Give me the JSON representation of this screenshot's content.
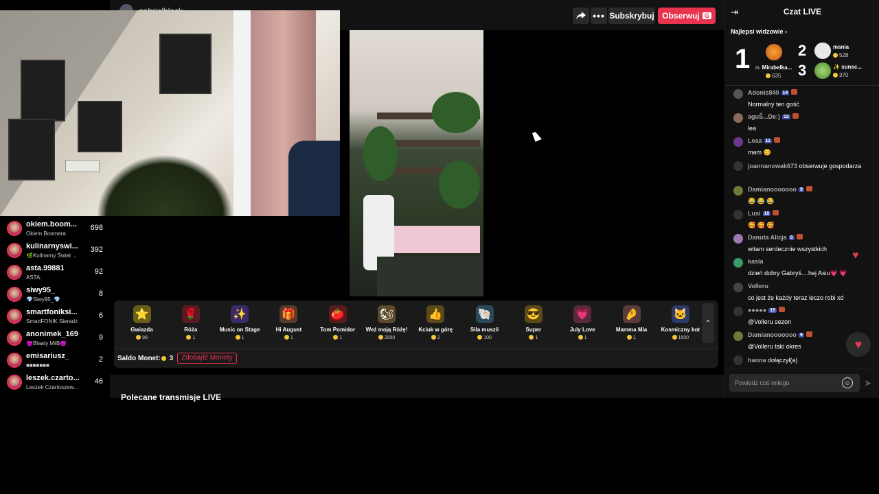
{
  "header": {
    "host_name": "gabrielblack",
    "share_icon": "share-icon",
    "more_label": "•••",
    "subscribe_label": "Subskrybuj",
    "follow_label": "Obserwuj",
    "follow_shortcut": "G"
  },
  "ranking": [
    {
      "name": "okiem.boom...",
      "sub": "Okiem Boomera",
      "score": "698"
    },
    {
      "name": "kulinarnyswi...",
      "sub": "🌿Kulinarny Świat ...",
      "score": "392"
    },
    {
      "name": "asta.99881",
      "sub": "ASTA.",
      "score": "92"
    },
    {
      "name": "siwy95_",
      "sub": "💎Siwy95_💎",
      "score": "8"
    },
    {
      "name": "smartfoniksi...",
      "sub": "SmartFONIK Sieradz",
      "score": "6"
    },
    {
      "name": "anonimek_169",
      "sub": "😈Blaaty Mił$😈",
      "score": "9"
    },
    {
      "name": "emisariusz_",
      "sub": "■■■■■■■",
      "score": "2"
    },
    {
      "name": "leszek.czarto...",
      "sub": "Leszek Czartoszew...",
      "score": "46"
    }
  ],
  "gifts": [
    {
      "name": "Gwiazda",
      "price": "99",
      "icon": "⭐",
      "color": "#6b5d1a"
    },
    {
      "name": "Róża",
      "price": "1",
      "icon": "🌹",
      "color": "#5a1a22"
    },
    {
      "name": "Music on Stage",
      "price": "1",
      "icon": "✨",
      "color": "#3a2a6a"
    },
    {
      "name": "Hi August",
      "price": "1",
      "icon": "🎁",
      "color": "#5a3a2a"
    },
    {
      "name": "Tom Pomidor",
      "price": "1",
      "icon": "🍅",
      "color": "#5a1a1a"
    },
    {
      "name": "Weź moją Różę!",
      "price": "2000",
      "icon": "🐿",
      "color": "#5a4a2a"
    },
    {
      "name": "Kciuk w górę",
      "price": "2",
      "icon": "👍",
      "color": "#5a4a1a"
    },
    {
      "name": "Siła muszli",
      "price": "100",
      "icon": "🐚",
      "color": "#2a4a5a"
    },
    {
      "name": "Super",
      "price": "1",
      "icon": "😎",
      "color": "#5a4a1a"
    },
    {
      "name": "July Love",
      "price": "1",
      "icon": "💗",
      "color": "#5a2a3a"
    },
    {
      "name": "Mamma Mia",
      "price": "1",
      "icon": "🤌",
      "color": "#5a3a3a"
    },
    {
      "name": "Kosmiczny kot",
      "price": "1500",
      "icon": "🐱",
      "color": "#2a3a6a"
    }
  ],
  "balance": {
    "label": "Saldo Monet:",
    "value": "3",
    "get_coins": "Zdobądź Monety"
  },
  "recommended_title": "Polecane transmisje LIVE",
  "chat": {
    "title": "Czat LIVE",
    "top_viewers": "Najlepsi widzowie",
    "podium": [
      {
        "rank": "1",
        "name": "Mirabelka...",
        "prefix": "PL",
        "score": "635"
      },
      {
        "rank": "2",
        "name": "mania",
        "score": "528"
      },
      {
        "rank": "3",
        "name": "✨ sunsc...",
        "score": "370"
      }
    ],
    "messages": [
      {
        "user": "Adonis840",
        "level": "14",
        "text": "Normalny ten gość"
      },
      {
        "user": "aguŠ...De:)",
        "level": "12",
        "text": "lea"
      },
      {
        "user": "Leaa",
        "level": "11",
        "text": "mam 😊"
      },
      {
        "user": "joannanowak673",
        "text": "obserwuje gospodarza"
      },
      {
        "user": "Damianooooooo",
        "level": "9",
        "text": "😂 😂 😂"
      },
      {
        "user": "Lusi",
        "level": "10",
        "text": "🥰 🥰 🥰"
      },
      {
        "user": "Danuta Alicja",
        "level": "6",
        "text": "witam serdecznie wszystkich"
      },
      {
        "user": "kasia",
        "text": "dzień dobry Gabryś....hej Asiu💗 💗"
      },
      {
        "user": "Volleru",
        "text": "co jest że każdy teraz leczo robi xd"
      },
      {
        "user": "●●●●●",
        "level": "15",
        "text": "@Volleru sezon"
      },
      {
        "user": "Damianooooooo",
        "level": "9",
        "text": "@Volleru taki okres"
      },
      {
        "user": "hanna",
        "text": "dołączył(a)"
      }
    ],
    "input_placeholder": "Powiedz coś miłego",
    "accent": "#e8344f"
  }
}
